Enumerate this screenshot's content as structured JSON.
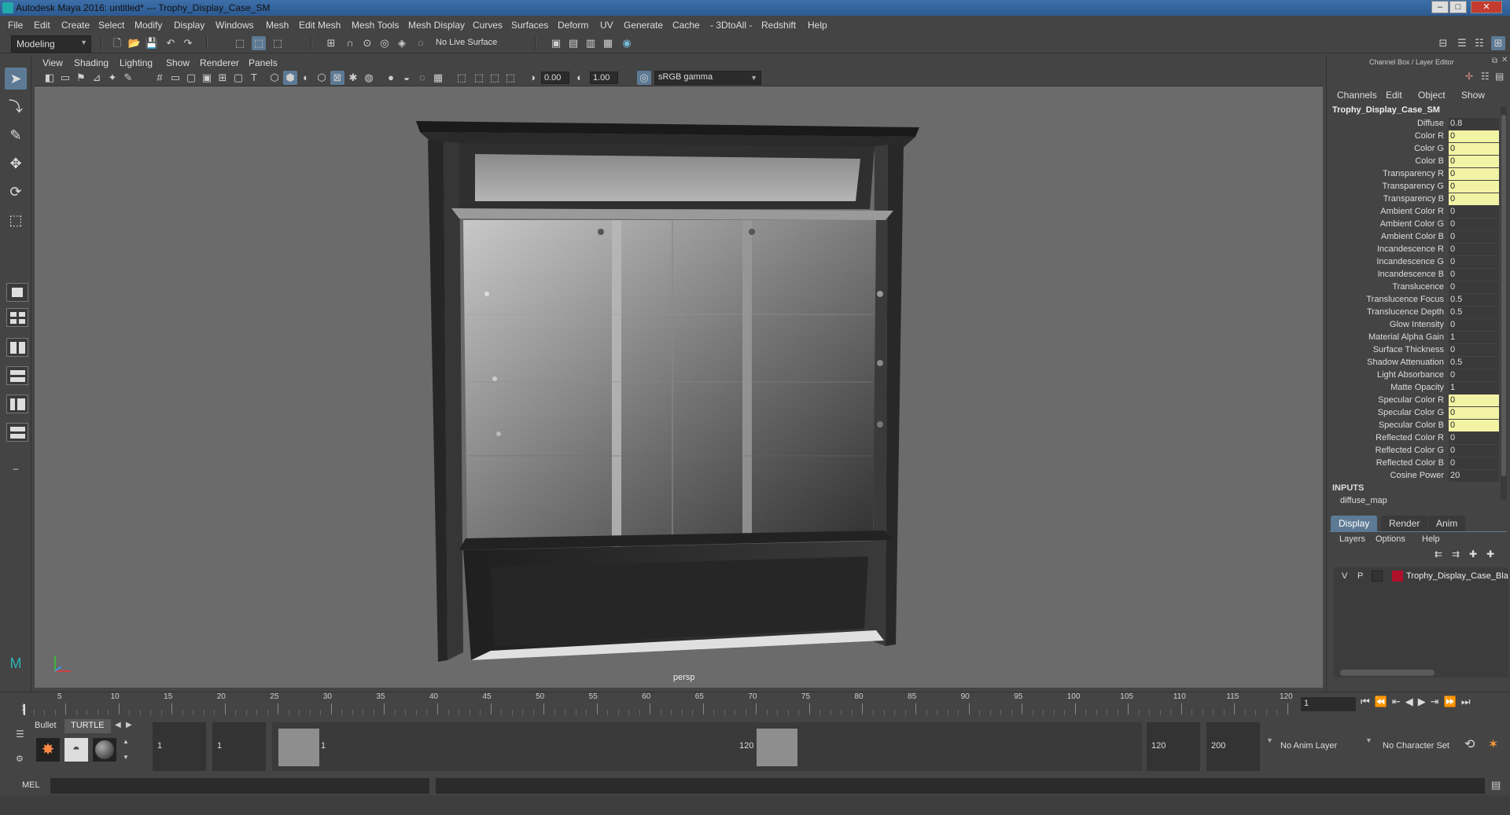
{
  "window": {
    "title": "Autodesk Maya 2016: untitled*   ---   Trophy_Display_Case_SM"
  },
  "menubar": [
    "File",
    "Edit",
    "Create",
    "Select",
    "Modify",
    "Display",
    "Windows",
    "Mesh",
    "Edit Mesh",
    "Mesh Tools",
    "Mesh Display",
    "Curves",
    "Surfaces",
    "Deform",
    "UV",
    "Generate",
    "Cache",
    "- 3DtoAll -",
    "Redshift",
    "Help"
  ],
  "statusline": {
    "mode": "Modeling",
    "live_surface": "No Live Surface"
  },
  "viewport": {
    "menu": [
      "View",
      "Shading",
      "Lighting",
      "Show",
      "Renderer",
      "Panels"
    ],
    "exposure": "0.00",
    "gamma": "1.00",
    "color_space": "sRGB gamma",
    "camera_label": "persp"
  },
  "channel_box": {
    "header": "Channel Box / Layer Editor",
    "menu": [
      "Channels",
      "Edit",
      "Object",
      "Show"
    ],
    "node_name": "Trophy_Display_Case_SM",
    "attributes": [
      {
        "label": "Diffuse",
        "value": "0.8",
        "keyed": false
      },
      {
        "label": "Color R",
        "value": "0",
        "keyed": true
      },
      {
        "label": "Color G",
        "value": "0",
        "keyed": true
      },
      {
        "label": "Color B",
        "value": "0",
        "keyed": true
      },
      {
        "label": "Transparency R",
        "value": "0",
        "keyed": true
      },
      {
        "label": "Transparency G",
        "value": "0",
        "keyed": true
      },
      {
        "label": "Transparency B",
        "value": "0",
        "keyed": true
      },
      {
        "label": "Ambient Color R",
        "value": "0",
        "keyed": false
      },
      {
        "label": "Ambient Color G",
        "value": "0",
        "keyed": false
      },
      {
        "label": "Ambient Color B",
        "value": "0",
        "keyed": false
      },
      {
        "label": "Incandescence R",
        "value": "0",
        "keyed": false
      },
      {
        "label": "Incandescence G",
        "value": "0",
        "keyed": false
      },
      {
        "label": "Incandescence B",
        "value": "0",
        "keyed": false
      },
      {
        "label": "Translucence",
        "value": "0",
        "keyed": false
      },
      {
        "label": "Translucence Focus",
        "value": "0.5",
        "keyed": false
      },
      {
        "label": "Translucence Depth",
        "value": "0.5",
        "keyed": false
      },
      {
        "label": "Glow Intensity",
        "value": "0",
        "keyed": false
      },
      {
        "label": "Material Alpha Gain",
        "value": "1",
        "keyed": false
      },
      {
        "label": "Surface Thickness",
        "value": "0",
        "keyed": false
      },
      {
        "label": "Shadow Attenuation",
        "value": "0.5",
        "keyed": false
      },
      {
        "label": "Light Absorbance",
        "value": "0",
        "keyed": false
      },
      {
        "label": "Matte Opacity",
        "value": "1",
        "keyed": false
      },
      {
        "label": "Specular Color R",
        "value": "0",
        "keyed": true
      },
      {
        "label": "Specular Color G",
        "value": "0",
        "keyed": true
      },
      {
        "label": "Specular Color B",
        "value": "0",
        "keyed": true
      },
      {
        "label": "Reflected Color R",
        "value": "0",
        "keyed": false
      },
      {
        "label": "Reflected Color G",
        "value": "0",
        "keyed": false
      },
      {
        "label": "Reflected Color B",
        "value": "0",
        "keyed": false
      },
      {
        "label": "Cosine Power",
        "value": "20",
        "keyed": false
      }
    ],
    "inputs_label": "INPUTS",
    "input_node": "diffuse_map"
  },
  "layer_editor": {
    "tabs": [
      "Display",
      "Render",
      "Anim"
    ],
    "menu": [
      "Layers",
      "Options",
      "Help"
    ],
    "layer": {
      "v": "V",
      "p": "P",
      "name": "Trophy_Display_Case_Bla",
      "color": "#b0102a"
    }
  },
  "timeline": {
    "ticks": [
      "1",
      "5",
      "10",
      "15",
      "20",
      "25",
      "30",
      "35",
      "40",
      "45",
      "50",
      "55",
      "60",
      "65",
      "70",
      "75",
      "80",
      "85",
      "90",
      "95",
      "100",
      "105",
      "110",
      "115",
      "120"
    ],
    "current_frame": "1"
  },
  "range": {
    "shelf_tabs": [
      "Bullet",
      "TURTLE"
    ],
    "start": "1",
    "playback_start": "1",
    "slider_start": "1",
    "slider_end": "120",
    "playback_end": "120",
    "end": "200",
    "anim_layer": "No Anim Layer",
    "character_set": "No Character Set"
  },
  "cmdline": {
    "label": "MEL"
  }
}
